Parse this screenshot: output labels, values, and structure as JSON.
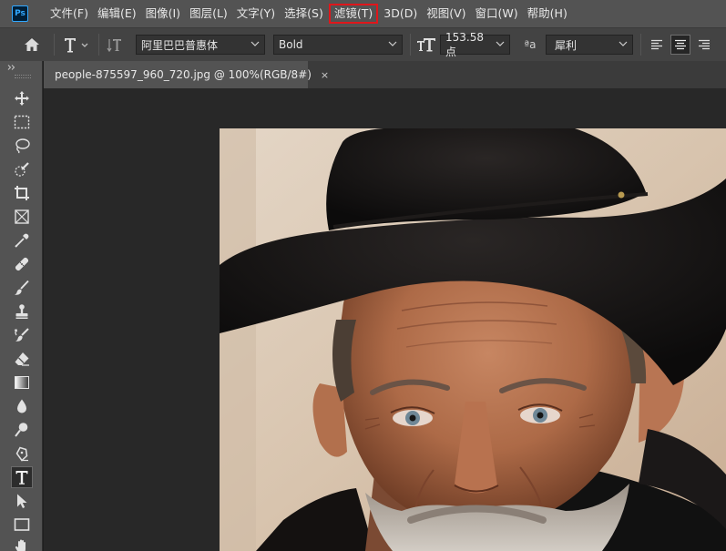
{
  "app": {
    "logo_text": "Ps"
  },
  "menu": {
    "items": [
      "文件(F)",
      "编辑(E)",
      "图像(I)",
      "图层(L)",
      "文字(Y)",
      "选择(S)",
      "滤镜(T)",
      "3D(D)",
      "视图(V)",
      "窗口(W)",
      "帮助(H)"
    ],
    "highlighted": "滤镜(T)"
  },
  "options": {
    "font_family": "阿里巴巴普惠体",
    "font_style": "Bold",
    "font_size": "153.58 点",
    "antialias_label": "ªa",
    "antialias": "犀利",
    "text_align_active": "center"
  },
  "document": {
    "tab_title": "people-875597_960_720.jpg @ 100%(RGB/8#)",
    "close_glyph": "×"
  },
  "tools": [
    "move-tool",
    "marquee-tool",
    "lasso-tool",
    "quick-select-tool",
    "crop-tool",
    "frame-tool",
    "eyedropper-tool",
    "healing-brush-tool",
    "brush-tool",
    "clone-stamp-tool",
    "history-brush-tool",
    "eraser-tool",
    "gradient-tool",
    "blur-tool",
    "dodge-tool",
    "pen-tool",
    "type-tool",
    "path-select-tool",
    "rectangle-tool",
    "hand-tool"
  ],
  "active_tool": "type-tool",
  "colors": {
    "menubar": "#535353",
    "optionsbar": "#434343",
    "canvas": "#282828",
    "highlight": "#e0161b"
  }
}
